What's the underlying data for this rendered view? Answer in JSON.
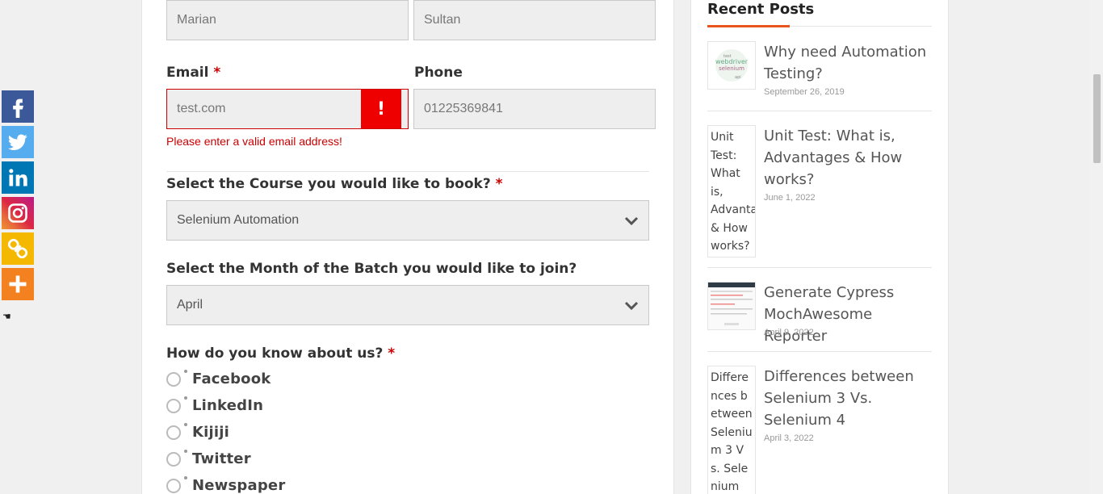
{
  "share_bar": {
    "buttons": [
      {
        "name": "facebook",
        "icon": "facebook-icon",
        "color": "#3b5998"
      },
      {
        "name": "twitter",
        "icon": "twitter-icon",
        "color": "#55acee"
      },
      {
        "name": "linkedin",
        "icon": "linkedin-icon",
        "color": "#0077b5"
      },
      {
        "name": "instagram",
        "icon": "instagram-icon",
        "color": "#dc2743"
      },
      {
        "name": "copy-link",
        "icon": "link-icon",
        "color": "#f5b800"
      },
      {
        "name": "more",
        "icon": "plus-icon",
        "color": "#f48120"
      }
    ],
    "hide_icon": "hand-pointer-icon"
  },
  "form": {
    "first_name_value": "Marian",
    "last_name_value": "Sultan",
    "email_label": "Email",
    "email_required": "*",
    "email_value": "test.com",
    "email_error_icon": "!",
    "email_error": "Please enter a valid email address!",
    "phone_label": "Phone",
    "phone_value": "01225369841",
    "course_label": "Select the Course you would like to book?",
    "course_required": "*",
    "course_value": "Selenium Automation",
    "month_label": "Select the Month of the Batch you would like to join?",
    "month_value": "April",
    "source_label": "How do you know about us?",
    "source_required": "*",
    "source_options": [
      "Facebook",
      "LinkedIn",
      "Kijiji",
      "Twitter",
      "Newspaper"
    ],
    "error_color": "#cc0000"
  },
  "sidebar": {
    "title": "Recent Posts",
    "accent_color": "#e8541e",
    "posts": [
      {
        "title": "Why need Automation Testing?",
        "date": "September 26, 2019",
        "thumb_alt": ""
      },
      {
        "title": "Unit Test: What is, Advantages & How works?",
        "date": "June 1, 2022",
        "thumb_alt": "Unit Test: What is, Advantages & How works?"
      },
      {
        "title": "Generate Cypress MochAwesome Reporter",
        "date": "April 9, 2022",
        "thumb_alt": ""
      },
      {
        "title": "Differences between Selenium 3 Vs. Selenium 4",
        "date": "April 3, 2022",
        "thumb_alt": "Differences between Selenium 3 Vs. Selenium"
      }
    ]
  }
}
